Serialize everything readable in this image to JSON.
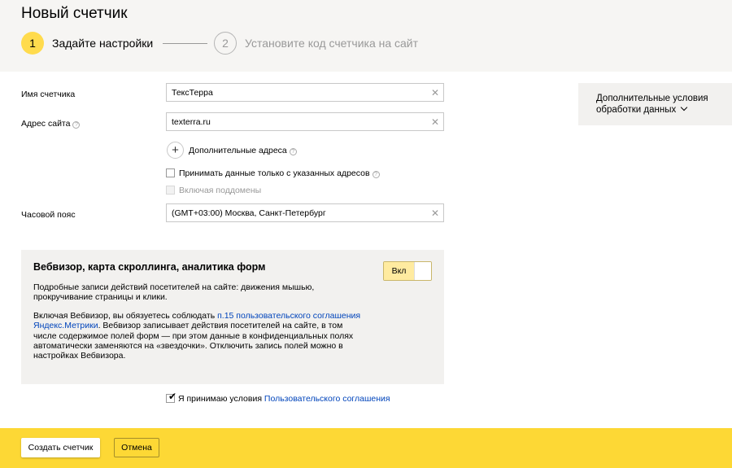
{
  "header": {
    "title": "Новый счетчик",
    "step1": {
      "number": "1",
      "label": "Задайте настройки"
    },
    "step2": {
      "number": "2",
      "label": "Установите код счетчика на сайт"
    }
  },
  "form": {
    "name": {
      "label": "Имя счетчика",
      "value": "ТексТерра"
    },
    "site": {
      "label": "Адрес сайта",
      "value": "texterra.ru"
    },
    "additional_addresses": {
      "label": "Дополнительные адреса"
    },
    "accept_only": {
      "label": "Принимать данные только с указанных адресов",
      "checked": false
    },
    "subdomains": {
      "label": "Включая поддомены",
      "checked": false,
      "disabled": true
    },
    "timezone": {
      "label": "Часовой пояс",
      "value": "(GMT+03:00) Москва, Санкт-Петербург"
    }
  },
  "advanced": {
    "line1": "Дополнительные условия",
    "line2": "обработки данных"
  },
  "webvisor": {
    "title": "Вебвизор, карта скроллинга, аналитика форм",
    "toggle_label": "Вкл",
    "desc": "Подробные записи действий посетителей на сайте: движения мышью, прокручивание страницы и клики.",
    "p2_before": "Включая Вебвизор, вы обязуетесь соблюдать ",
    "p2_link": "п.15 пользовательского соглашения Яндекс.Метрики",
    "p2_after": ". Вебвизор записывает действия посетителей на сайте, в том числе содержимое полей форм — при этом данные в конфиденциальных полях автоматически заменяются на «звездочки». Отключить запись полей можно в настройках Вебвизора."
  },
  "agreement": {
    "checked": true,
    "text": "Я принимаю условия ",
    "link": "Пользовательского соглашения"
  },
  "footer": {
    "create_label": "Создать счетчик",
    "cancel_label": "Отмена"
  },
  "icons": {
    "help": "help-icon",
    "clear": "close-icon",
    "add": "plus-icon",
    "chevron": "chevron-down-icon",
    "check": "checkmark-icon"
  },
  "colors": {
    "accent": "#ffdb4d",
    "footer": "#fdd835",
    "link": "#0044bb",
    "panel": "#f2f1ef"
  }
}
